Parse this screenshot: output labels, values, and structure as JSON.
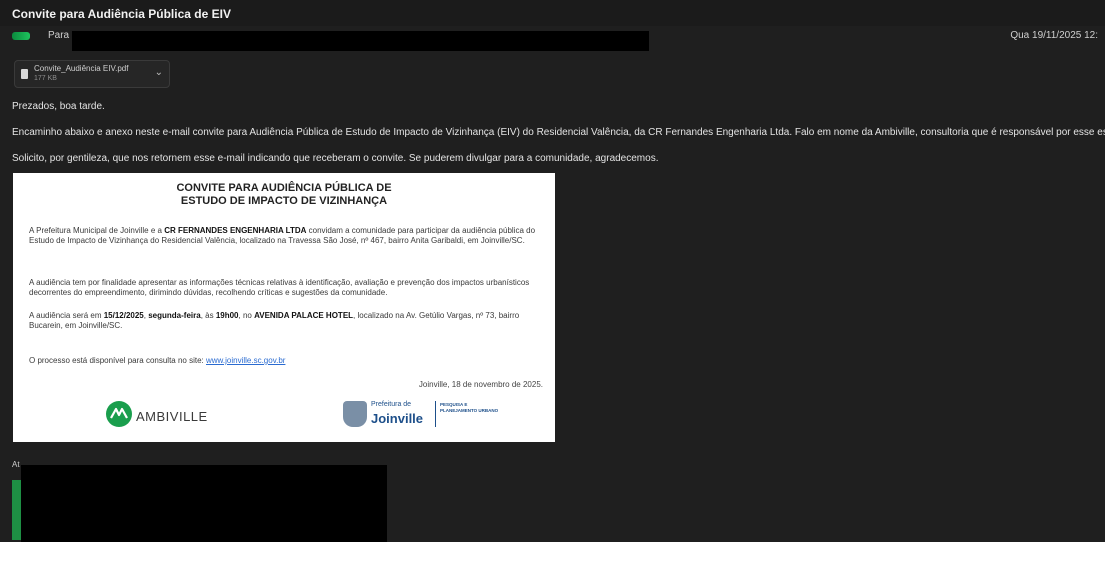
{
  "window": {
    "title": "Convite para Audiência Pública de EIV"
  },
  "header": {
    "to_label": "Para",
    "date": "Qua 19/11/2025 12:"
  },
  "attachment": {
    "filename": "Convite_Audiência EIV.pdf",
    "size": "177 KB"
  },
  "message": {
    "greeting": "Prezados, boa tarde.",
    "line1": "Encaminho abaixo e anexo neste e-mail convite para Audiência Pública de Estudo de Impacto de Vizinhança (EIV) do Residencial Valência, da CR Fernandes Engenharia Ltda. Falo em nome da Ambiville, consultoria que é responsável por esse estudo.",
    "line2": "Solicito, por gentileza, que nos retornem esse e-mail indicando que receberam o convite. Se puderem divulgar para a comunidade, agradecemos.",
    "signature_initial": "At"
  },
  "invite": {
    "title_line1": "CONVITE PARA AUDIÊNCIA PÚBLICA DE",
    "title_line2": "ESTUDO DE IMPACTO DE VIZINHANÇA",
    "p1_a": "A Prefeitura Municipal de Joinville e a ",
    "p1_bold": "CR FERNANDES ENGENHARIA LTDA",
    "p1_b": " convidam a comunidade para participar da audiência pública do Estudo de Impacto de Vizinhança do Residencial Valência, localizado na Travessa São José, nº 467, bairro Anita Garibaldi, em Joinville/SC.",
    "p2": "A audiência tem por finalidade apresentar as informações técnicas relativas à identificação, avaliação e prevenção dos impactos urbanísticos decorrentes do empreendimento, dirimindo dúvidas, recolhendo críticas e sugestões da comunidade.",
    "p3_a": "A audiência será em ",
    "p3_date": "15/12/2025",
    "p3_sep": ", ",
    "p3_day": "segunda-feira",
    "p3_b": ", às ",
    "p3_time": "19h00",
    "p3_c": ", no ",
    "p3_place": "AVENIDA PALACE HOTEL",
    "p3_d": ", localizado na Av. Getúlio Vargas, nº 73, bairro Bucarein, em Joinville/SC.",
    "p4_a": "O processo está disponível para consulta no site: ",
    "p4_link": "www.joinville.sc.gov.br",
    "date_place": "Joinville, 18 de novembro de 2025.",
    "logo_ambiville": "AMBIVILLE",
    "logo_pref": "Prefeitura de",
    "logo_joinville": "Joinville",
    "logo_secretaria": "PESQUISA E PLANEJAMENTO URBANO"
  }
}
